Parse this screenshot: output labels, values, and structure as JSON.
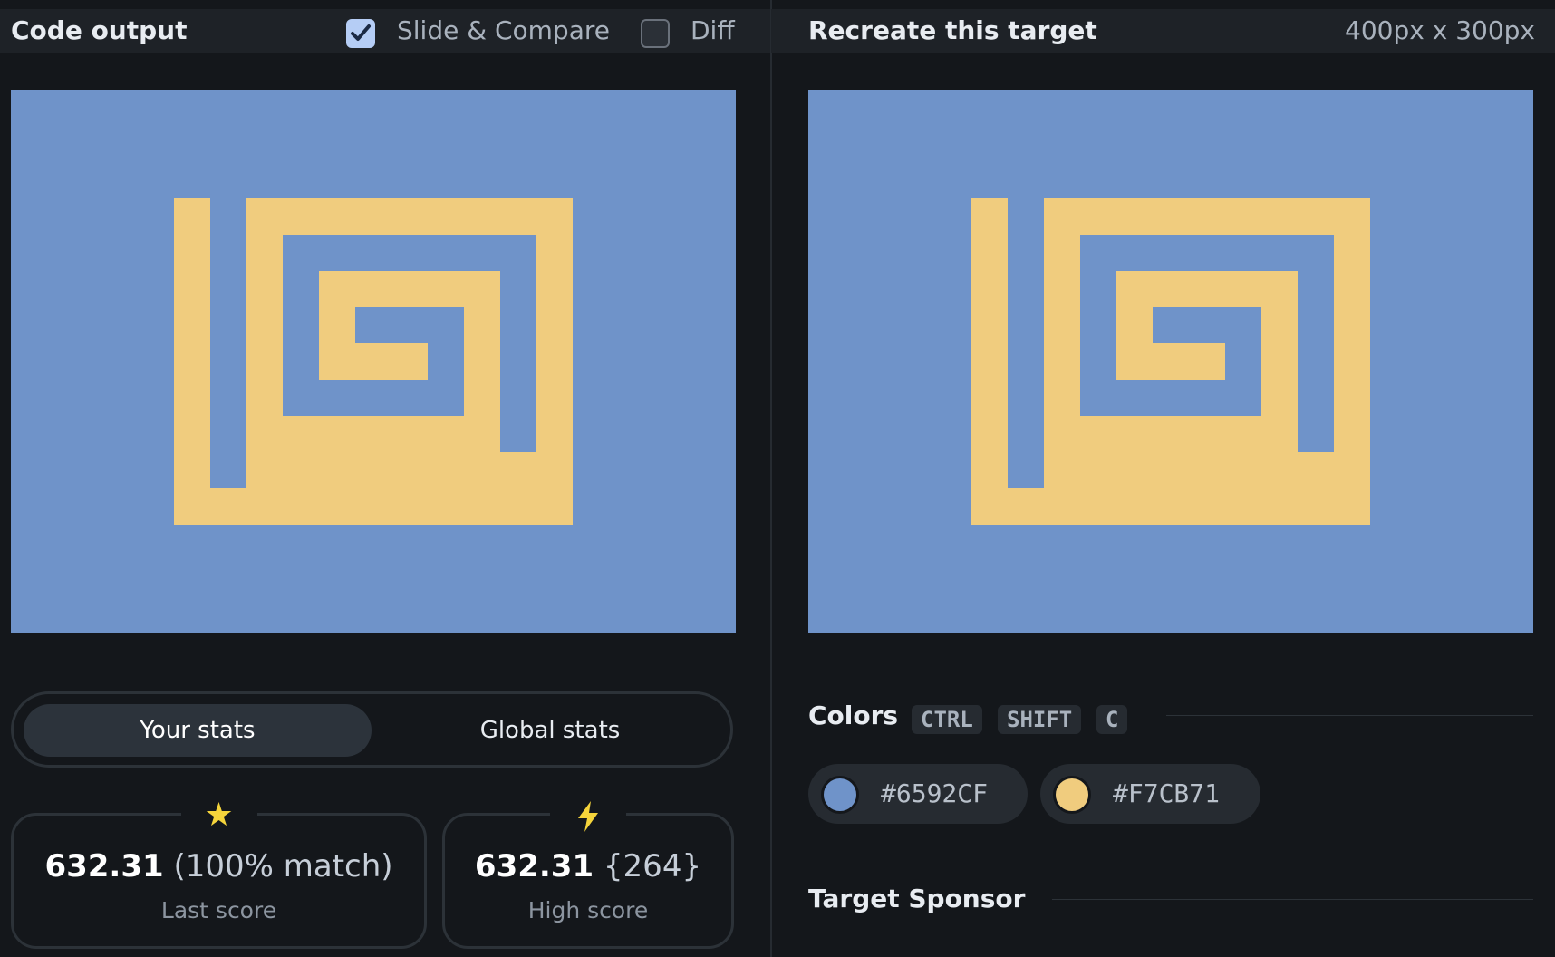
{
  "code_output": {
    "title": "Code output",
    "slide_compare": {
      "label": "Slide & Compare",
      "checked": true
    },
    "diff": {
      "label": "Diff",
      "checked": false
    }
  },
  "target": {
    "title": "Recreate this target",
    "dimensions": "400px x 300px"
  },
  "stats": {
    "tabs": [
      {
        "label": "Your stats",
        "active": true
      },
      {
        "label": "Global stats",
        "active": false
      }
    ],
    "last_score": {
      "icon": "star-icon",
      "value": "632.31",
      "extra": "(100% match)",
      "caption": "Last score"
    },
    "high_score": {
      "icon": "lightning-icon",
      "value": "632.31",
      "extra": "{264}",
      "caption": "High score"
    }
  },
  "colors": {
    "title": "Colors",
    "shortcut": [
      "CTRL",
      "SHIFT",
      "C"
    ],
    "swatches": [
      {
        "hex": "#6592CF"
      },
      {
        "hex": "#F7CB71"
      }
    ]
  },
  "sponsor": {
    "title": "Target Sponsor"
  },
  "palette": {
    "background": "#6592CF",
    "foreground": "#F7CB71"
  }
}
